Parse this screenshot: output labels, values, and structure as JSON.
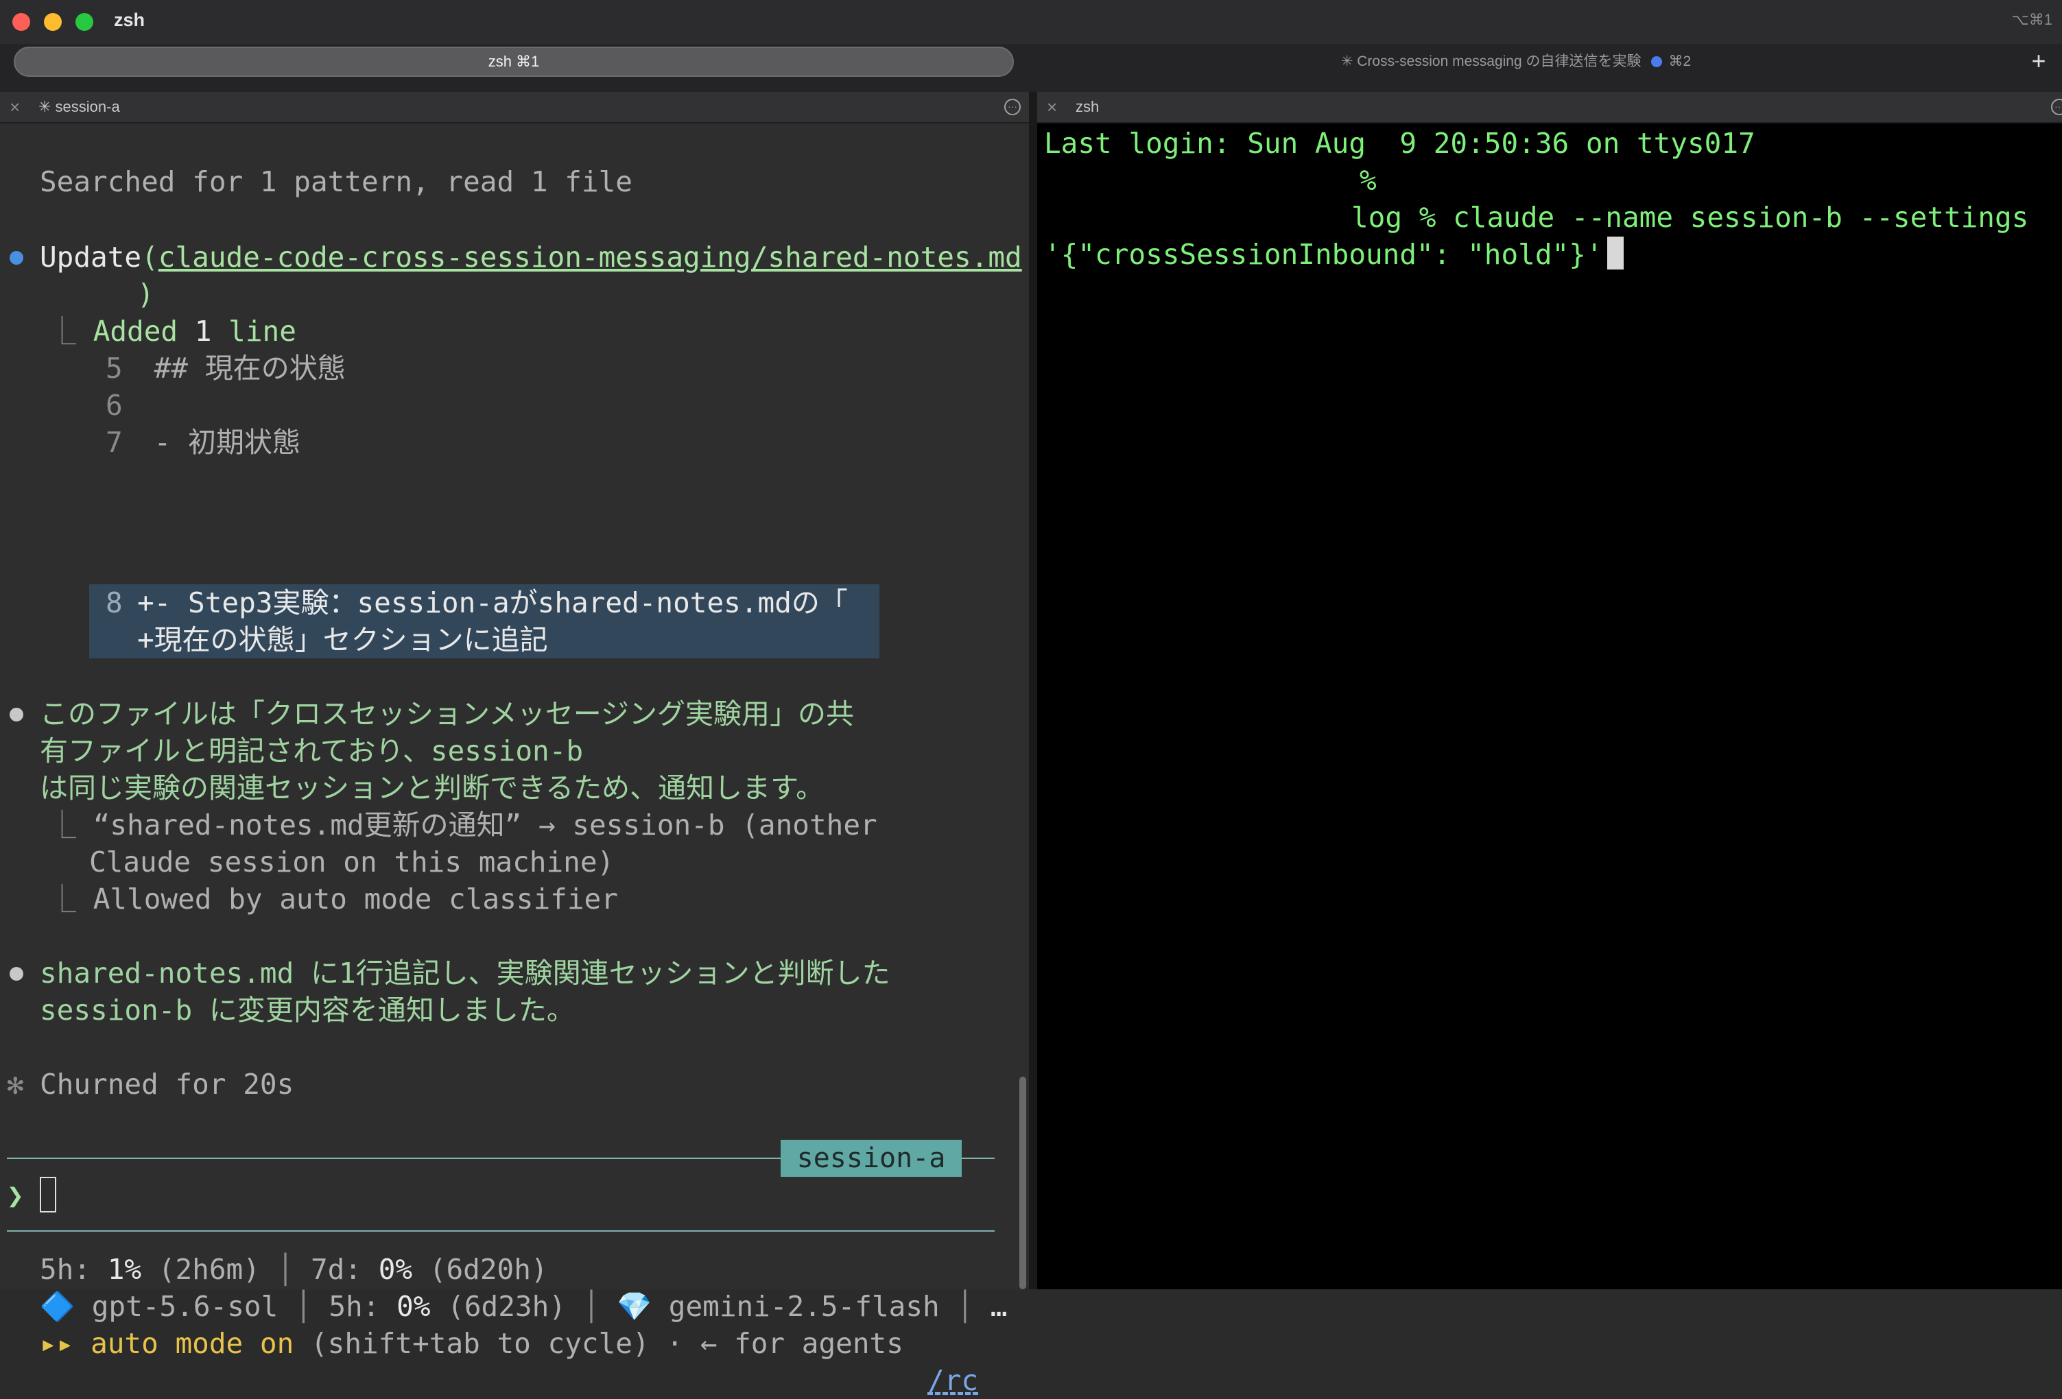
{
  "window": {
    "title": "zsh",
    "shortcut": "⌥⌘1"
  },
  "tabs": [
    {
      "label": "zsh ⌘1"
    },
    {
      "label": "✳ Cross-session messaging の自律送信を実験",
      "shortcut": "⌘2"
    }
  ],
  "left_pane": {
    "header": "✳ session-a",
    "lines": {
      "searched": "Searched for 1 pattern, read 1 file",
      "update_word": "Update",
      "update_open": "(",
      "update_path": "claude-code-cross-session-messaging/shared-notes.md",
      "update_close": ")",
      "added_prefix": "Added ",
      "added_count": "1",
      "added_suffix": " line",
      "diff_5_num": "5",
      "diff_5_text": " ## 現在の状態",
      "diff_6_num": "6",
      "diff_7_num": "7",
      "diff_7_text": " - 初期状態",
      "diff_8_num": "8",
      "diff_8_text": "+- Step3実験：session-aがshared-notes.mdの「",
      "diff_8b_text": "+現在の状態」セクションに追記",
      "msg1_l1": "このファイルは「クロスセッションメッセージング実験用」の共",
      "msg1_l2": "有ファイルと明記されており、session-b",
      "msg1_l3": "は同じ実験の関連セッションと判断できるため、通知します。",
      "notify_l1": "“shared-notes.md更新の通知” → session-b (another",
      "notify_l2": "Claude session on this machine)",
      "allowed": "Allowed by auto mode classifier",
      "msg2_l1": "shared-notes.md に1行追記し、実験関連セッションと判断した",
      "msg2_l2": "session-b に変更内容を通知しました。",
      "churned_star": "✻",
      "churned": "Churned for 20s",
      "prompt": "❯"
    },
    "session_badge": "session-a",
    "status": {
      "l1_a": "5h: ",
      "l1_b": "1%",
      "l1_c": " (2h6m)",
      "l1_d": "7d: ",
      "l1_e": "0%",
      "l1_f": " (6d20h)",
      "model1_icon": "🔷",
      "model1": "gpt-5.6-sol",
      "m_5h": "5h: ",
      "m_5h_pct": "0%",
      "m_5h_time": " (6d23h)",
      "model2_icon": "💎",
      "model2": "gemini-2.5-flash",
      "ellipsis": "…",
      "auto_arrows": "▸▸",
      "auto_on": "auto mode on",
      "auto_hint": " (shift+tab to cycle) · ← for agents",
      "rc": "/rc"
    }
  },
  "right_pane": {
    "header": "zsh",
    "lines": [
      "Last login: Sun Aug  9 20:50:36 on ttys017",
      "% ",
      "log % claude --name session-b --settings",
      "'{\"crossSessionInbound\": \"hold\"}'"
    ]
  },
  "colors": {
    "accent_green": "#a6e3a1",
    "badge_teal": "#5fa8a3",
    "terminal_green": "#7ef07a"
  }
}
